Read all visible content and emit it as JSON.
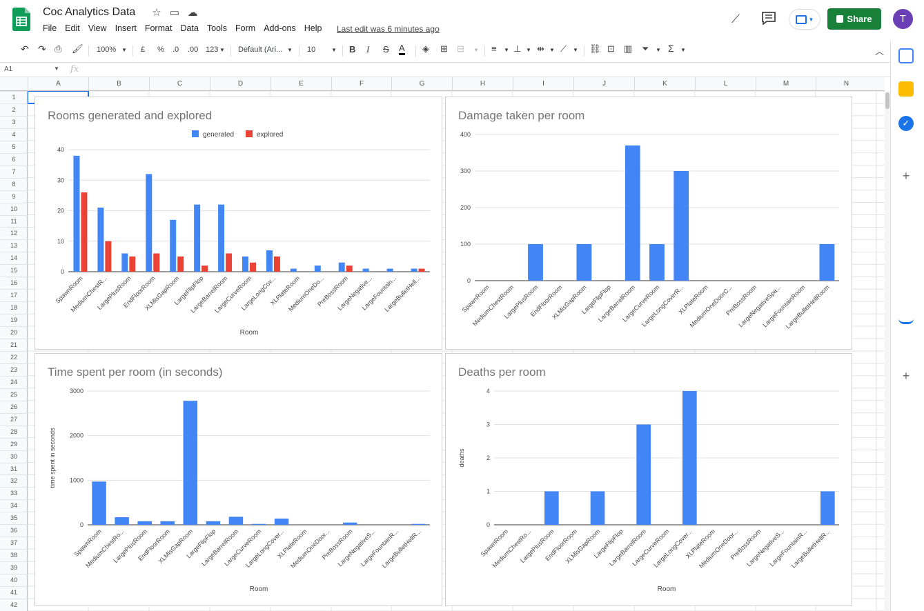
{
  "header": {
    "doc_title": "Coc Analytics Data",
    "menus": [
      "File",
      "Edit",
      "View",
      "Insert",
      "Format",
      "Data",
      "Tools",
      "Form",
      "Add-ons",
      "Help"
    ],
    "last_edit": "Last edit was 6 minutes ago",
    "share_label": "Share",
    "avatar_letter": "T",
    "brand_green": "#188038",
    "avatar_color": "#6a3fb5"
  },
  "toolbar": {
    "zoom": "100%",
    "currency": "£",
    "percent": "%",
    "dec_less": ".0",
    "dec_more": ".00",
    "format_more": "123",
    "font_family": "Default (Ari...",
    "font_size": "10",
    "bold": "B",
    "italic": "I",
    "strike": "S",
    "text_color": "A",
    "sum": "Σ"
  },
  "formula_bar": {
    "name_box": "A1",
    "fx": "fx"
  },
  "grid": {
    "columns": [
      "A",
      "B",
      "C",
      "D",
      "E",
      "F",
      "G",
      "H",
      "I",
      "J",
      "K",
      "L",
      "M",
      "N"
    ],
    "rows": [
      "1",
      "2",
      "3",
      "4",
      "5",
      "6",
      "7",
      "8",
      "9",
      "10",
      "11",
      "12",
      "13",
      "14",
      "15",
      "16",
      "17",
      "18",
      "19",
      "20",
      "21",
      "22",
      "23",
      "24",
      "25",
      "26",
      "27",
      "28",
      "29",
      "30",
      "31",
      "32",
      "33",
      "34",
      "35",
      "36",
      "37",
      "38",
      "39",
      "40",
      "41",
      "42"
    ]
  },
  "chart_data": [
    {
      "type": "bar",
      "title": "Rooms generated and explored",
      "xlabel": "Room",
      "ylabel": "",
      "ylim": [
        0,
        40
      ],
      "yticks": [
        0,
        10,
        20,
        30,
        40
      ],
      "legend": "top-center",
      "categories": [
        "SpawnRoom",
        "MediumChestR...",
        "LargePlusRoom",
        "EndFloorRoom",
        "XLMisGapRoom",
        "LargeFlipFlop",
        "LargeBarrelRoom",
        "LargeCurveRoom",
        "LargeLongCov...",
        "XLPlateRoom",
        "MediumOneDo...",
        "PreBossRoom",
        "LargeNegative...",
        "LargeFountain...",
        "LargeBulletHell..."
      ],
      "series": [
        {
          "name": "generated",
          "color": "#4285f4",
          "values": [
            38,
            21,
            6,
            32,
            17,
            22,
            22,
            5,
            7,
            1,
            2,
            3,
            1,
            1,
            1
          ]
        },
        {
          "name": "explored",
          "color": "#ea4335",
          "values": [
            26,
            10,
            5,
            6,
            5,
            2,
            6,
            3,
            5,
            0,
            0,
            2,
            0,
            0,
            1
          ]
        }
      ]
    },
    {
      "type": "bar",
      "title": "Damage taken per room",
      "xlabel": "",
      "ylabel": "",
      "ylim": [
        0,
        400
      ],
      "yticks": [
        0,
        100,
        200,
        300,
        400
      ],
      "categories": [
        "SpawnRoom",
        "MediumChestRoom",
        "LargePlusRoom",
        "EndFloorRoom",
        "XLMisGapRoom",
        "LargeFlipFlop",
        "LargeBarrelRoom",
        "LargeCurveRoom",
        "LargeLongCoverR...",
        "XLPlateRoom",
        "MediumOneDoorC...",
        "PreBossRoom",
        "LargeNegativeSpa...",
        "LargeFountainRoom",
        "LargeBulletHellRoom"
      ],
      "series": [
        {
          "color": "#4285f4",
          "values": [
            0,
            0,
            100,
            0,
            100,
            0,
            370,
            100,
            300,
            0,
            0,
            0,
            0,
            0,
            100
          ]
        }
      ]
    },
    {
      "type": "bar",
      "title": "Time spent per room (in seconds)",
      "xlabel": "Room",
      "ylabel": "time spent in seconds",
      "ylim": [
        0,
        3000
      ],
      "yticks": [
        0,
        1000,
        2000,
        3000
      ],
      "categories": [
        "SpawnRoom",
        "MediumChestRo...",
        "LargePlusRoom",
        "EndFloorRoom",
        "XLMisGapRoom",
        "LargeFlipFlop",
        "LargeBarrelRoom",
        "LargeCurveRoom",
        "LargeLongCover...",
        "XLPlateRoom",
        "MediumOneDoor...",
        "PreBossRoom",
        "LargeNegativeS...",
        "LargeFountainR...",
        "LargeBulletHellR..."
      ],
      "series": [
        {
          "color": "#4285f4",
          "values": [
            970,
            170,
            80,
            80,
            2780,
            80,
            180,
            20,
            140,
            0,
            0,
            50,
            0,
            0,
            20
          ]
        }
      ]
    },
    {
      "type": "bar",
      "title": "Deaths per room",
      "xlabel": "Room",
      "ylabel": "deaths",
      "ylim": [
        0,
        4
      ],
      "yticks": [
        0,
        1,
        2,
        3,
        4
      ],
      "categories": [
        "SpawnRoom",
        "MediumChestRo...",
        "LargePlusRoom",
        "EndFloorRoom",
        "XLMisGapRoom",
        "LargeFlipFlop",
        "LargeBarrelRoom",
        "LargeCurveRoom",
        "LargeLongCover...",
        "XLPlateRoom",
        "MediumOneDoor...",
        "PreBossRoom",
        "LargeNegativeS...",
        "LargeFountainR...",
        "LargeBulletHellR..."
      ],
      "series": [
        {
          "color": "#4285f4",
          "values": [
            0,
            0,
            1,
            0,
            1,
            0,
            3,
            0,
            4,
            0,
            0,
            0,
            0,
            0,
            1
          ]
        }
      ]
    }
  ]
}
